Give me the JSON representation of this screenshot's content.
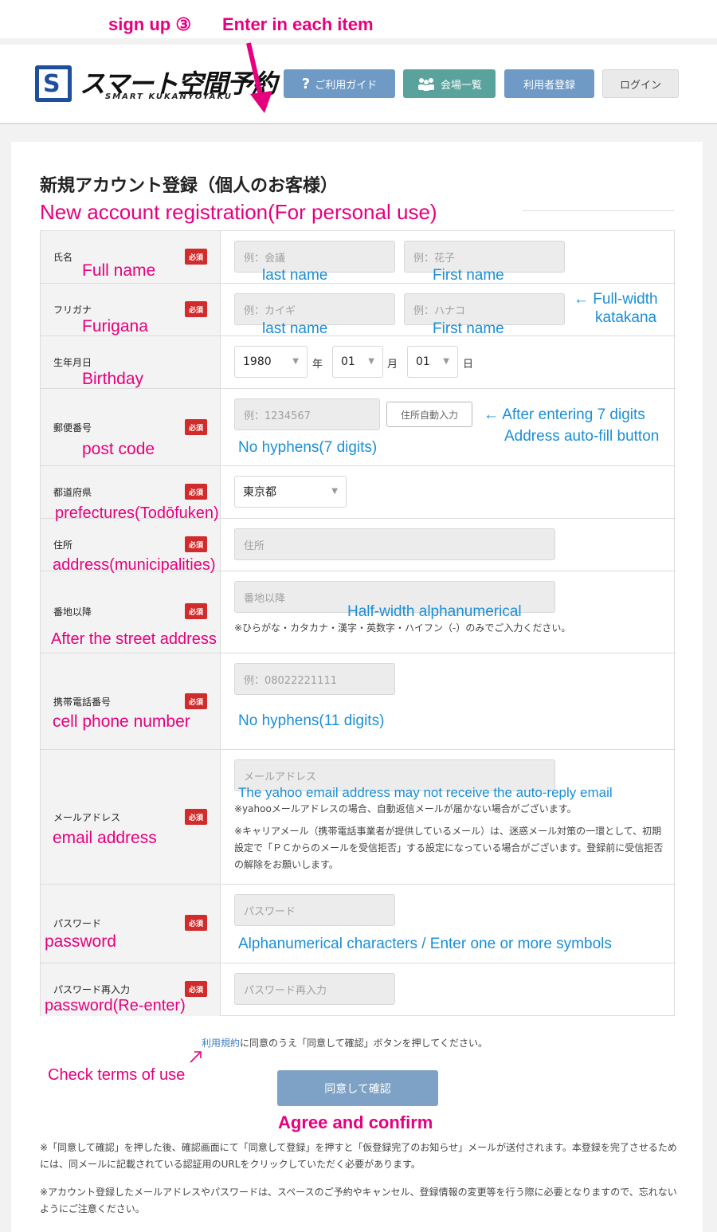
{
  "annotations": {
    "step": "sign up ③",
    "instruction": "Enter in each item",
    "title_en": "New account registration(For personal use)",
    "full_name": "Full name",
    "last_name": "last name",
    "first_name": "First name",
    "furigana": "Furigana",
    "last_name2": "last name",
    "first_name2": "First name",
    "fullwidth_katakana_1": "← Full-width",
    "fullwidth_katakana_2": "katakana",
    "birthday": "Birthday",
    "post_code": "post code",
    "no_hyphens_7": "No hyphens(7 digits)",
    "after_7_digits": "← After entering 7 digits",
    "autofill_button": "Address auto-fill button",
    "prefectures": "prefectures(Todōfuken)",
    "address": "address(municipalities)",
    "half_width": "Half-width alphanumerical",
    "after_street": "After the street address",
    "cell_phone": "cell phone number",
    "no_hyphens_11": "No hyphens(11 digits)",
    "yahoo_note": "The yahoo email address may not receive the auto-reply email",
    "email": "email address",
    "password": "password",
    "password_rule": "Alphanumerical characters  /  Enter one or more symbols",
    "password_re": "password(Re-enter)",
    "check_terms": "Check terms of use",
    "agree_confirm": "Agree and confirm"
  },
  "header": {
    "logo_text": "スマート空間予約",
    "logo_sub": "SMART KUKANYOYAKU",
    "nav": {
      "guide": "ご利用ガイド",
      "venues": "会場一覧",
      "register": "利用者登録",
      "login": "ログイン"
    },
    "colors": {
      "guide": "#6f9ac6",
      "venues": "#5aa39c",
      "register": "#6f9ac6",
      "login": "#eaeaea",
      "pink": "#e6007e",
      "blue": "#1a8fd6"
    }
  },
  "page": {
    "title": "新規アカウント登録（個人のお客様）"
  },
  "form": {
    "required_badge": "必須",
    "name": {
      "label": "氏名",
      "last_placeholder": "例：会議",
      "first_placeholder": "例：花子"
    },
    "furigana": {
      "label": "フリガナ",
      "last_placeholder": "例：カイギ",
      "first_placeholder": "例：ハナコ"
    },
    "birthday": {
      "label": "生年月日",
      "year": "1980",
      "year_unit": "年",
      "month": "01",
      "month_unit": "月",
      "day": "01",
      "day_unit": "日"
    },
    "postal": {
      "label": "郵便番号",
      "placeholder": "例：1234567",
      "autofill_label": "住所自動入力"
    },
    "prefecture": {
      "label": "都道府県",
      "value": "東京都"
    },
    "address": {
      "label": "住所",
      "placeholder": "住所"
    },
    "street": {
      "label": "番地以降",
      "placeholder": "番地以降",
      "note": "※ひらがな・カタカナ・漢字・英数字・ハイフン（-）のみでご入力ください。"
    },
    "phone": {
      "label": "携帯電話番号",
      "placeholder": "例：08022221111"
    },
    "email": {
      "label": "メールアドレス",
      "placeholder": "メールアドレス",
      "note1": "※yahooメールアドレスの場合、自動返信メールが届かない場合がございます。",
      "note2": "※キャリアメール（携帯電話事業者が提供しているメール）は、迷惑メール対策の一環として、初期設定で「ＰＣからのメールを受信拒否」する設定になっている場合がございます。登録前に受信拒否の解除をお願いします。"
    },
    "password": {
      "label": "パスワード",
      "placeholder": "パスワード"
    },
    "password_confirm": {
      "label": "パスワード再入力",
      "placeholder": "パスワード再入力"
    }
  },
  "terms": {
    "link": "利用規約",
    "text": "に同意のうえ「同意して確認」ボタンを押してください。"
  },
  "submit_label": "同意して確認",
  "footer": {
    "note1": "※「同意して確認」を押した後、確認画面にて「同意して登録」を押すと「仮登録完了のお知らせ」メールが送付されます。本登録を完了させるためには、同メールに記載されている認証用のURLをクリックしていただく必要があります。",
    "note2": "※アカウント登録したメールアドレスやパスワードは、スペースのご予約やキャンセル、登録情報の変更等を行う際に必要となりますので、忘れないようにご注意ください。"
  }
}
